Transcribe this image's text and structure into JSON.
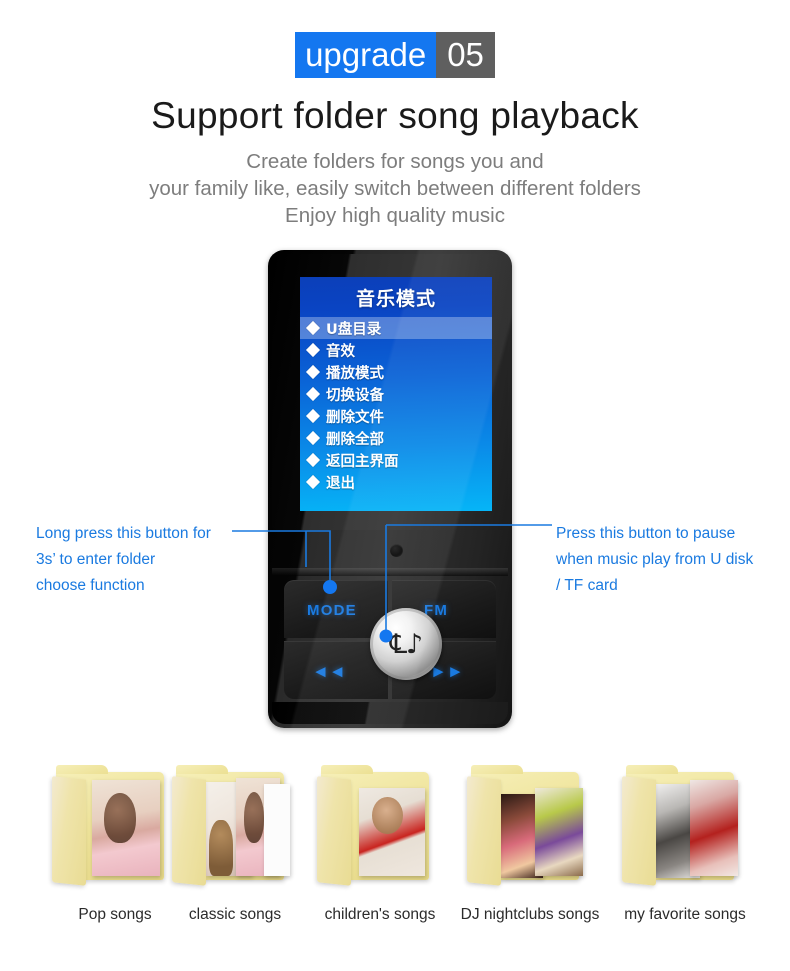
{
  "badge": {
    "label": "upgrade",
    "number": "05"
  },
  "heading": {
    "title": "Support  folder song playback"
  },
  "subtitle": {
    "line1": "Create folders for songs you and",
    "line2": "your family like, easily switch between different folders",
    "line3": "Enjoy high quality music"
  },
  "device": {
    "screen": {
      "title": "音乐模式",
      "menu": [
        {
          "label": "U盘目录",
          "selected": true
        },
        {
          "label": "音效",
          "selected": false
        },
        {
          "label": "播放模式",
          "selected": false
        },
        {
          "label": "切换设备",
          "selected": false
        },
        {
          "label": "删除文件",
          "selected": false
        },
        {
          "label": "删除全部",
          "selected": false
        },
        {
          "label": "返回主界面",
          "selected": false
        },
        {
          "label": "退出",
          "selected": false
        }
      ]
    },
    "keys": {
      "mode": "MODE",
      "fm": "FM",
      "previous": "◄◄",
      "next": "►►",
      "center_glyph": "℄♪"
    }
  },
  "annotations": {
    "left": {
      "line1": "Long press this button for",
      "line2": "3s’ to enter folder",
      "line3": " choose function"
    },
    "right": {
      "line1": "Press this button to pause",
      "line2": "when music play from U disk",
      "line3": "/ TF card"
    }
  },
  "folders": [
    {
      "caption": "Pop songs"
    },
    {
      "caption": "classic songs"
    },
    {
      "caption": "children's songs"
    },
    {
      "caption": "DJ nightclubs songs"
    },
    {
      "caption": "my favorite songs"
    }
  ],
  "colors": {
    "accent_blue": "#1477f0",
    "badge_gray": "#5f5f5f",
    "annotation_blue": "#1a7ae0",
    "title_dark": "#1a1a1a",
    "subtitle_gray": "#7d7d7d",
    "folder_yellow": "#efe49b",
    "background": "#ffffff"
  }
}
